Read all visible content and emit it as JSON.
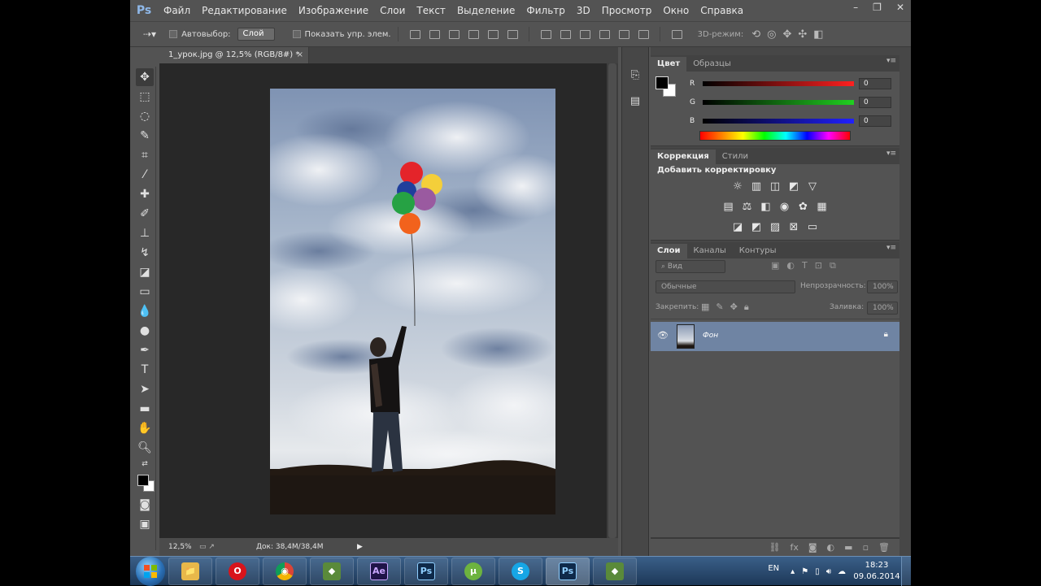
{
  "menubar": {
    "logo": "Ps",
    "items": [
      "Файл",
      "Редактирование",
      "Изображение",
      "Слои",
      "Текст",
      "Выделение",
      "Фильтр",
      "3D",
      "Просмотр",
      "Окно",
      "Справка"
    ],
    "controls": [
      "–",
      "❐",
      "✕"
    ]
  },
  "options": {
    "autoselect_label": "Автовыбор:",
    "autoselect_value": "Слой",
    "show_controls_label": "Показать упр. элем.",
    "mode3d_label": "3D-режим:"
  },
  "document": {
    "tab_title": "1_урок.jpg @ 12,5% (RGB/8#) *",
    "tab_close": "×",
    "zoom": "12,5%",
    "doc_info": "Док: 38,4M/38,4M"
  },
  "color_panel": {
    "tabs": [
      "Цвет",
      "Образцы"
    ],
    "channels": [
      {
        "label": "R",
        "value": "0",
        "color": "#ff2020"
      },
      {
        "label": "G",
        "value": "0",
        "color": "#20d020"
      },
      {
        "label": "B",
        "value": "0",
        "color": "#2020ff"
      }
    ]
  },
  "adjustments_panel": {
    "tabs": [
      "Коррекция",
      "Стили"
    ],
    "heading": "Добавить корректировку"
  },
  "layers_panel": {
    "tabs": [
      "Слои",
      "Каналы",
      "Контуры"
    ],
    "filter_placeholder": "Вид",
    "blend_mode": "Обычные",
    "opacity_label": "Непрозрачность:",
    "opacity_value": "100%",
    "lock_label": "Закрепить:",
    "fill_label": "Заливка:",
    "fill_value": "100%",
    "layers": [
      {
        "name": "Фон"
      }
    ]
  },
  "taskbar": {
    "apps": [
      {
        "name": "explorer",
        "label": "📁",
        "color": "#e8b84a"
      },
      {
        "name": "opera",
        "label": "O",
        "color": "#d8141b"
      },
      {
        "name": "chrome",
        "label": "◉",
        "color": "#3b9b3b"
      },
      {
        "name": "camtasia",
        "label": "◆",
        "color": "#5a8a3a"
      },
      {
        "name": "after-effects",
        "label": "Ae",
        "color": "#1f1448"
      },
      {
        "name": "photoshop",
        "label": "Ps",
        "color": "#0f2a4a"
      },
      {
        "name": "utorrent",
        "label": "µ",
        "color": "#6db33f"
      },
      {
        "name": "skype",
        "label": "S",
        "color": "#16a6e6"
      },
      {
        "name": "photoshop-active",
        "label": "Ps",
        "color": "#0f2a4a"
      },
      {
        "name": "camtasia-rec",
        "label": "◆",
        "color": "#5a8a3a"
      }
    ],
    "language": "EN",
    "time": "18:23",
    "date": "09.06.2014"
  }
}
